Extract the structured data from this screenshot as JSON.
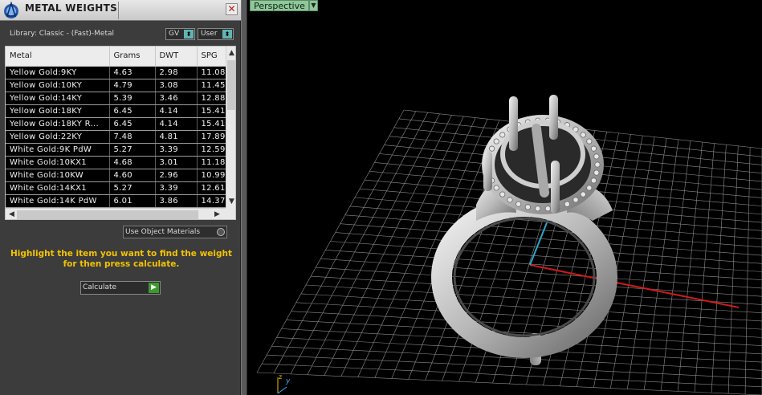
{
  "panel": {
    "title": "METAL WEIGHTS",
    "close_label": "✕",
    "library_label": "Library: Classic - (Fast)-Metal",
    "dropdown_gv": "GV",
    "dropdown_user": "User",
    "table": {
      "columns": [
        "Metal",
        "Grams",
        "DWT",
        "SPG"
      ],
      "rows": [
        [
          "Yellow Gold:9KY",
          "4.63",
          "2.98",
          "11.08"
        ],
        [
          "Yellow Gold:10KY",
          "4.79",
          "3.08",
          "11.45"
        ],
        [
          "Yellow Gold:14KY",
          "5.39",
          "3.46",
          "12.88"
        ],
        [
          "Yellow Gold:18KY",
          "6.45",
          "4.14",
          "15.41"
        ],
        [
          "Yellow Gold:18KY R...",
          "6.45",
          "4.14",
          "15.41"
        ],
        [
          "Yellow Gold:22KY",
          "7.48",
          "4.81",
          "17.89"
        ],
        [
          "White Gold:9K PdW",
          "5.27",
          "3.39",
          "12.59"
        ],
        [
          "White Gold:10KX1",
          "4.68",
          "3.01",
          "11.18"
        ],
        [
          "White Gold:10KW",
          "4.60",
          "2.96",
          "10.99"
        ],
        [
          "White Gold:14KX1",
          "5.27",
          "3.39",
          "12.61"
        ],
        [
          "White Gold:14K PdW",
          "6.01",
          "3.86",
          "14.37"
        ]
      ]
    },
    "use_object_materials": "Use Object Materials",
    "instructions": "Highlight the item you want to find the weight for then press calculate.",
    "calculate_label": "Calculate"
  },
  "viewport": {
    "view_name": "Perspective",
    "axis_z": "z",
    "axis_y": "y"
  },
  "colors": {
    "instruction_text": "#f2c200",
    "grid_line": "#9a9a9a",
    "x_axis": "#d21a1a",
    "y_axis": "#2aa6c8",
    "view_tab": "#8fc79b"
  }
}
